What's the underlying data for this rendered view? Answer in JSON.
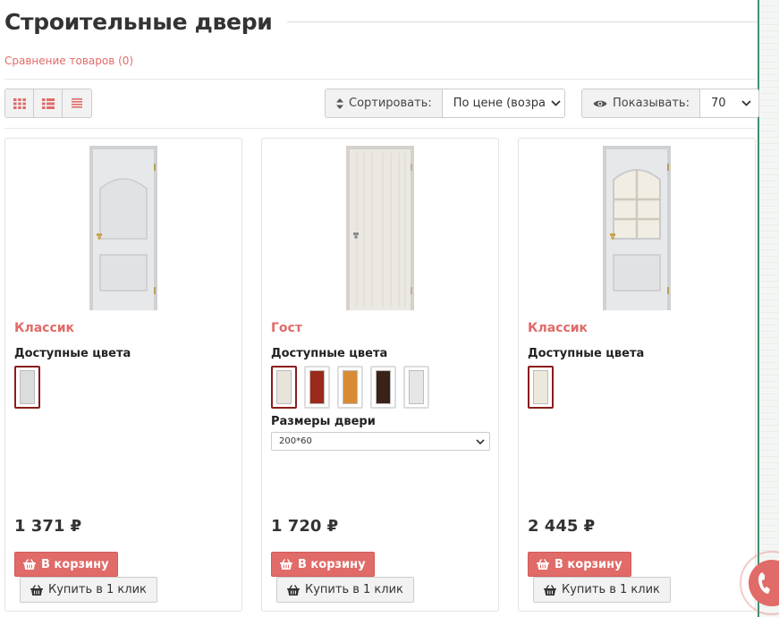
{
  "page": {
    "title": "Строительные двери",
    "compare_link": "Сравнение товаров (0)"
  },
  "toolbar": {
    "view_icons": [
      "grid-large-icon",
      "grid-list-icon",
      "list-icon"
    ],
    "sort": {
      "label": "Сортировать:",
      "value": "По цене (возра"
    },
    "show": {
      "label": "Показывать:",
      "value": "70"
    }
  },
  "products": [
    {
      "name": "Классик",
      "colors_label": "Доступные цвета",
      "swatches": [
        {
          "color": "#dcdcdc",
          "style": "panel",
          "active": true
        }
      ],
      "price": "1 371 ₽",
      "cart_button": "В корзину",
      "one_click_button": "Купить в 1 клик"
    },
    {
      "name": "Гост",
      "colors_label": "Доступные цвета",
      "swatches": [
        {
          "color": "#e8e4dc",
          "active": true
        },
        {
          "color": "#9b2a1a",
          "active": false
        },
        {
          "color": "#d98a35",
          "active": false
        },
        {
          "color": "#3b2219",
          "active": false
        },
        {
          "color": "#e4e6e8",
          "active": false
        }
      ],
      "size_label": "Размеры двери",
      "size_value": "200*60",
      "price": "1 720 ₽",
      "cart_button": "В корзину",
      "one_click_button": "Купить в 1 клик"
    },
    {
      "name": "Классик",
      "colors_label": "Доступные цвета",
      "swatches": [
        {
          "color": "#e2e2e2",
          "style": "glazed",
          "active": true
        }
      ],
      "price": "2 445 ₽",
      "cart_button": "В корзину",
      "one_click_button": "Купить в 1 клик"
    }
  ],
  "colors": {
    "accent": "#e06b68",
    "active_swatch_border": "#8b1c1c",
    "side_edge": "#3e8f72"
  }
}
